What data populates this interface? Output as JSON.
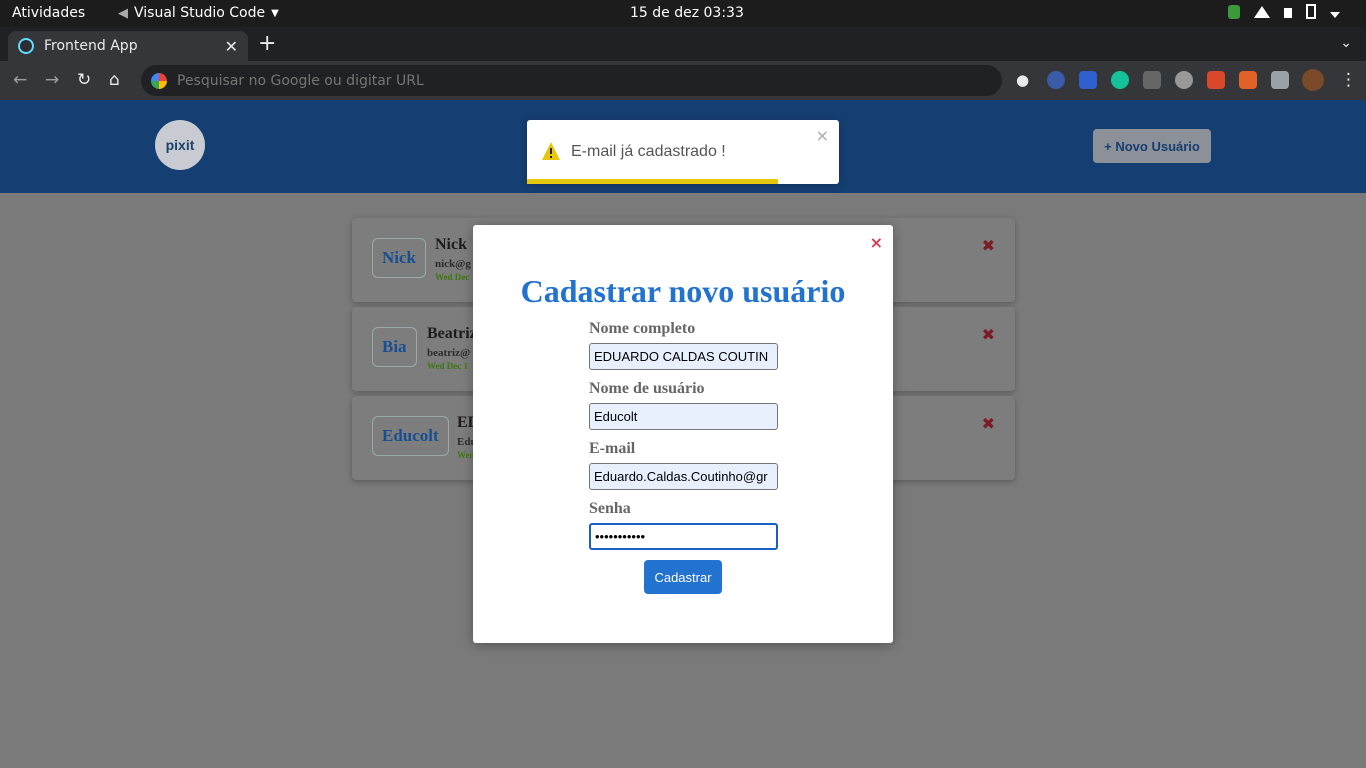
{
  "system_bar": {
    "activities": "Atividades",
    "app_name": "Visual Studio Code",
    "clock": "15 de dez  03:33"
  },
  "browser": {
    "tab_title": "Frontend App",
    "omnibox_placeholder": "Pesquisar no Google ou digitar URL"
  },
  "app": {
    "logo_text": "pixit",
    "new_user_button": "+ Novo Usuário",
    "cards": [
      {
        "nick": "Nick",
        "name": "Nick",
        "email": "nick@g",
        "date": "Wed Dec"
      },
      {
        "nick": "Bia",
        "name": "Beatriz",
        "email": "beatriz@",
        "date": "Wed Dec 1"
      },
      {
        "nick": "Educolt",
        "name": "ED",
        "email": "Edu",
        "date": "Wed"
      }
    ]
  },
  "toast": {
    "message": "E-mail já cadastrado !",
    "close": "×",
    "color": "#e6c70d"
  },
  "modal": {
    "close": "×",
    "title": "Cadastrar novo usuário",
    "fields": {
      "fullname_label": "Nome completo",
      "fullname_value": "EDUARDO CALDAS COUTIN",
      "username_label": "Nome de usuário",
      "username_value": "Educolt",
      "email_label": "E-mail",
      "email_value": "Eduardo.Caldas.Coutinho@gr",
      "password_label": "Senha",
      "password_value": "•••••••••••"
    },
    "submit_label": "Cadastrar",
    "accent_color": "#2272cf"
  }
}
